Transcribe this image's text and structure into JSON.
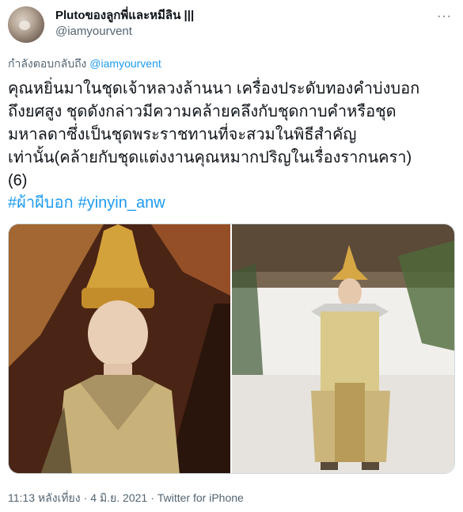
{
  "user": {
    "display_name": "Plutoของลูกพี่และหมีลิน |||",
    "handle": "@iamyourvent"
  },
  "reply": {
    "prefix": "กำลังตอบกลับถึง",
    "mention": "@iamyourvent"
  },
  "tweet": {
    "lines": [
      "คุณหยิ่นมาในชุดเจ้าหลวงล้านนา เครื่องประดับทองคำบ่งบอก",
      "ถึงยศสูง ชุดดังกล่าวมีความคล้ายคลึงกับชุดกาบคำหรือชุด",
      "มหาลดาซึ่งเป็นชุดพระราชทานที่จะสวมในพิธีสำคัญ",
      "เท่านั้น(คล้ายกับชุดแต่งงานคุณหมากปริญในเรื่องรากนครา)",
      "(6)"
    ],
    "hashtags": [
      "#ผ้าผีบอก",
      "#yinyin_anw"
    ]
  },
  "meta": {
    "time": "11:13 หลังเที่ยง",
    "date": "4 มิ.ย. 2021",
    "source": "Twitter for iPhone",
    "separator": "·"
  }
}
